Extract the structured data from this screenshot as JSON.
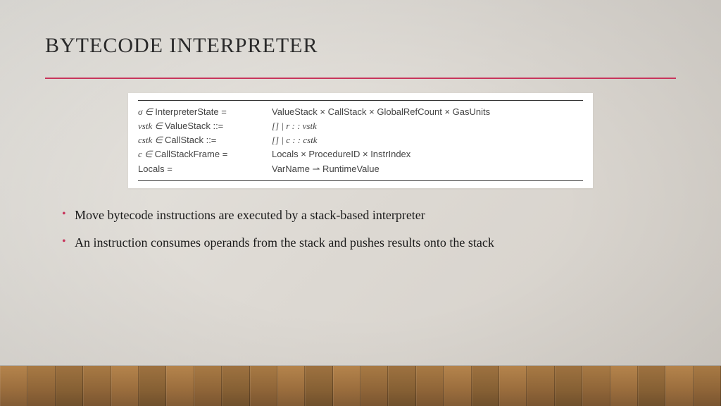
{
  "title": "BYTECODE INTERPRETER",
  "definitions": [
    {
      "left_sym": "σ ∈ ",
      "left_name": "InterpreterState",
      "left_op": " =",
      "right": "ValueStack × CallStack × GlobalRefCount × GasUnits"
    },
    {
      "left_sym": "vstk ∈ ",
      "left_name": "ValueStack",
      "left_op": " ::=",
      "right": " [] | r : :  vstk",
      "right_italic": true
    },
    {
      "left_sym": "cstk ∈ ",
      "left_name": "CallStack",
      "left_op": " ::=",
      "right": " [] | c : :  cstk",
      "right_italic": true
    },
    {
      "left_sym": "c ∈ ",
      "left_name": "CallStackFrame",
      "left_op": " =",
      "right": "Locals × ProcedureID × InstrIndex"
    },
    {
      "left_sym": "",
      "left_name": "Locals",
      "left_op": " =",
      "right": "VarName ⇀ RuntimeValue"
    }
  ],
  "bullets": [
    "Move bytecode instructions are executed by a stack-based interpreter",
    "An instruction consumes operands from the stack and pushes results onto the stack"
  ]
}
